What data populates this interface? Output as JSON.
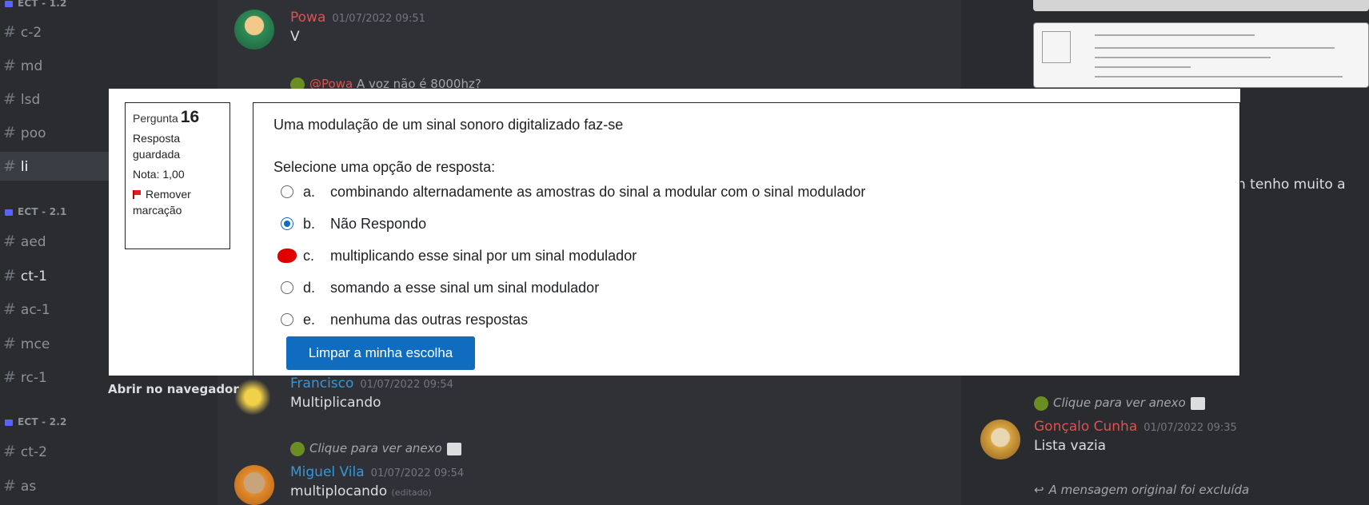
{
  "sidebar": {
    "categories": [
      {
        "label": "ECT - 1.2"
      },
      {
        "label": "ECT - 2.1"
      },
      {
        "label": "ECT - 2.2"
      }
    ],
    "channels": [
      {
        "label": "c-2"
      },
      {
        "label": "md"
      },
      {
        "label": "lsd"
      },
      {
        "label": "poo"
      },
      {
        "label": "li"
      },
      {
        "label": "aed"
      },
      {
        "label": "ct-1"
      },
      {
        "label": "ac-1"
      },
      {
        "label": "mce"
      },
      {
        "label": "rc-1"
      },
      {
        "label": "ct-2"
      },
      {
        "label": "as"
      }
    ]
  },
  "chat": {
    "messages": [
      {
        "author": "Powa",
        "timestamp": "01/07/2022 09:51",
        "text": "V",
        "author_color": "#e05050"
      },
      {
        "reply_mention": "@Powa",
        "reply_text": "A voz não é 8000hz?"
      },
      {
        "author": "Francisco",
        "timestamp": "01/07/2022 09:54",
        "text": "Multiplicando",
        "author_color": "#3498db"
      },
      {
        "reply_text": "Clique para ver anexo"
      },
      {
        "author": "Miguel Vila",
        "timestamp": "01/07/2022 09:54",
        "text": "multiplocando",
        "edited": "(editado)",
        "author_color": "#3498db"
      }
    ],
    "open_in_browser": "Abrir no navegador"
  },
  "right_panel": {
    "partial_text": "n tenho muito a",
    "reply_text": "Clique para ver anexo",
    "message": {
      "author": "Gonçalo Cunha",
      "timestamp": "01/07/2022 09:35",
      "text": "Lista vazia",
      "author_color": "#e05050"
    },
    "deleted_reply": "A mensagem original foi excluída"
  },
  "quiz": {
    "info": {
      "question_label": "Pergunta",
      "question_number": "16",
      "status": "Resposta guardada",
      "grade": "Nota: 1,00",
      "flag_action": "Remover marcação"
    },
    "question_text": "Uma modulação de um sinal sonoro digitalizado faz-se",
    "prompt": "Selecione uma opção de resposta:",
    "options": [
      {
        "letter": "a.",
        "text": "combinando alternadamente as amostras do sinal a modular com o sinal modulador"
      },
      {
        "letter": "b.",
        "text": "Não Respondo"
      },
      {
        "letter": "c.",
        "text": "multiplicando esse sinal por um sinal modulador"
      },
      {
        "letter": "d.",
        "text": "somando a esse sinal um sinal modulador"
      },
      {
        "letter": "e.",
        "text": "nenhuma das outras respostas"
      }
    ],
    "selected": "b.",
    "clear_button": "Limpar a minha escolha",
    "accent_color": "#0f6cbf",
    "annotation_color": "#e00000"
  }
}
